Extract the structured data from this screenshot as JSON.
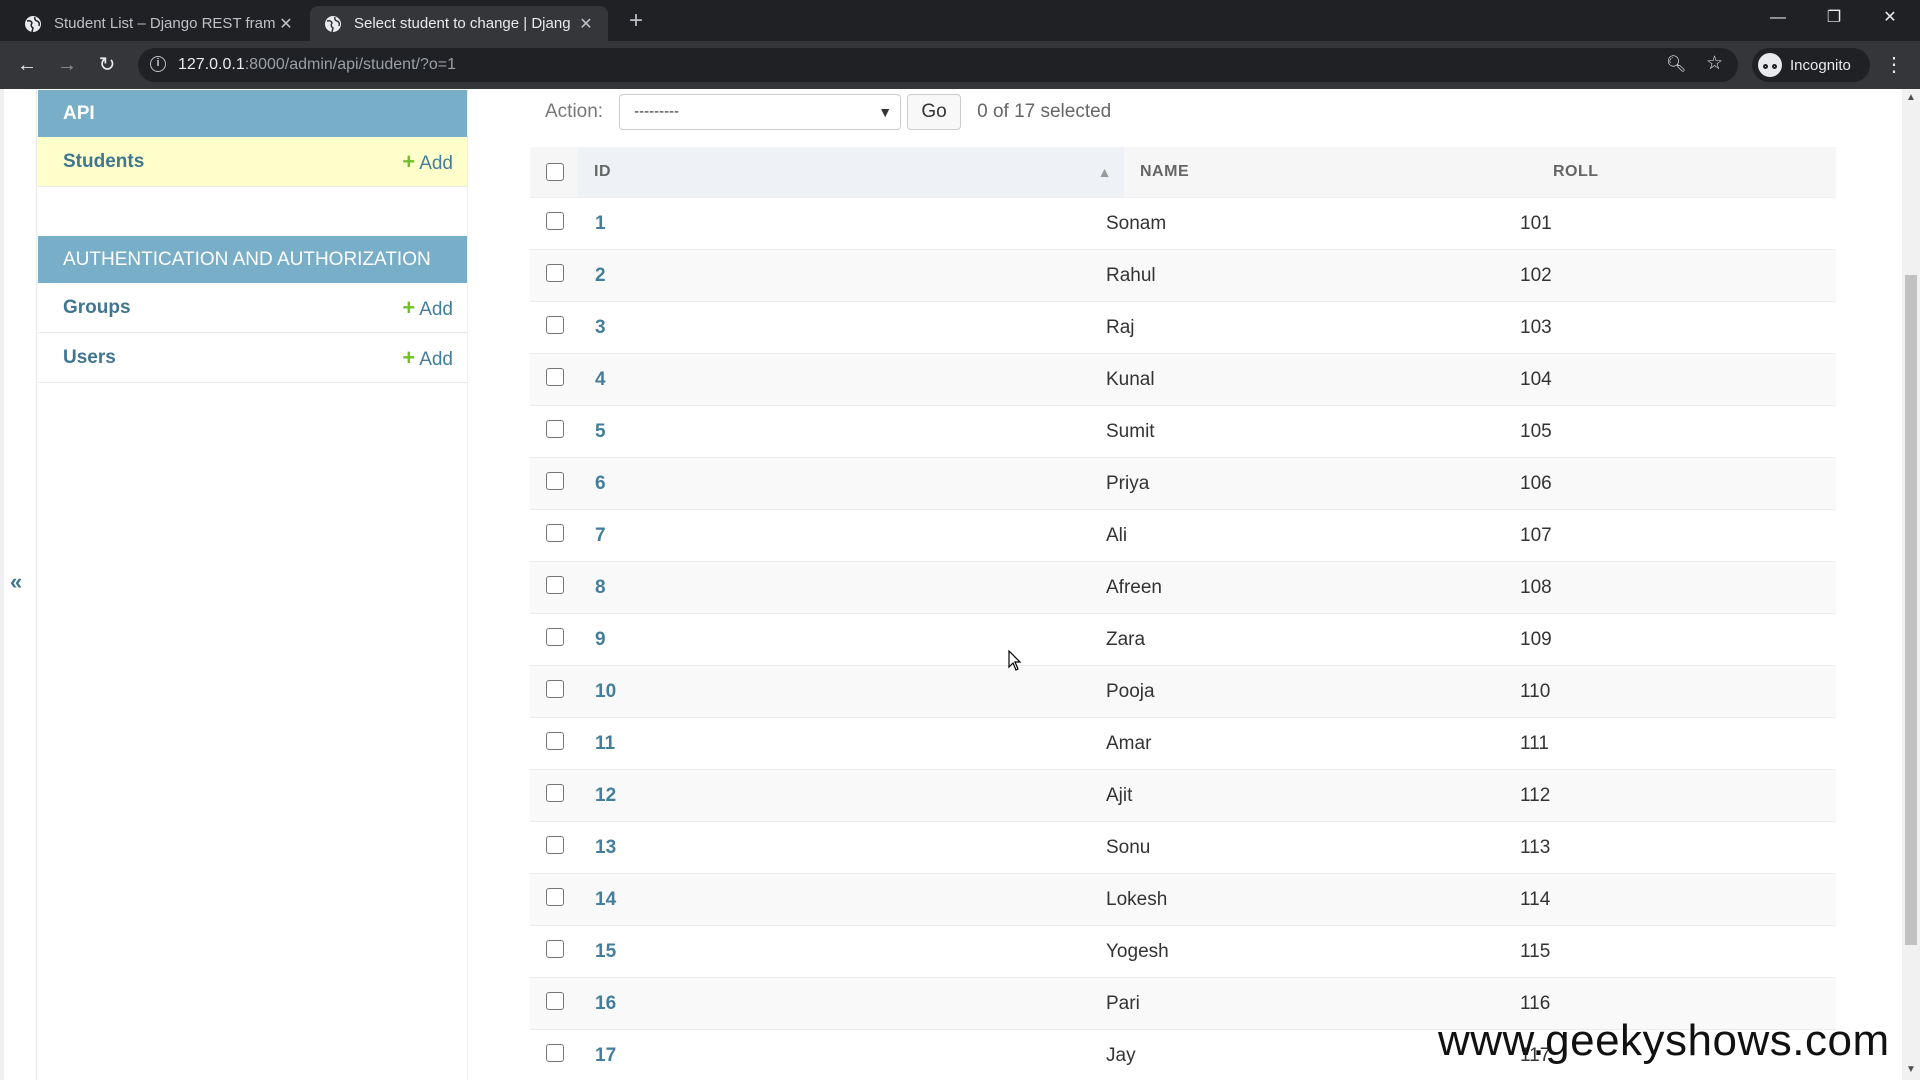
{
  "browser": {
    "tabs": [
      {
        "title": "Student List – Django REST frame",
        "active": false
      },
      {
        "title": "Select student to change | Djang",
        "active": true
      }
    ],
    "url_host": "127.0.0.1",
    "url_rest": ":8000/admin/api/student/?o=1",
    "profile_label": "Incognito",
    "window_controls": [
      "—",
      "❐",
      "✕"
    ]
  },
  "sidebar": {
    "collapse_label": "«",
    "modules": [
      {
        "caption": "API",
        "items": [
          {
            "label": "Students",
            "add": "Add",
            "current": true
          }
        ]
      },
      {
        "caption": "AUTHENTICATION AND AUTHORIZATION",
        "items": [
          {
            "label": "Groups",
            "add": "Add",
            "current": false
          },
          {
            "label": "Users",
            "add": "Add",
            "current": false
          }
        ]
      }
    ]
  },
  "actions": {
    "label": "Action:",
    "selected_option": "---------",
    "go_label": "Go",
    "counter": "0 of 17 selected"
  },
  "table": {
    "headers": {
      "id": "ID",
      "name": "NAME",
      "roll": "ROLL"
    },
    "rows": [
      {
        "id": "1",
        "name": "Sonam",
        "roll": "101"
      },
      {
        "id": "2",
        "name": "Rahul",
        "roll": "102"
      },
      {
        "id": "3",
        "name": "Raj",
        "roll": "103"
      },
      {
        "id": "4",
        "name": "Kunal",
        "roll": "104"
      },
      {
        "id": "5",
        "name": "Sumit",
        "roll": "105"
      },
      {
        "id": "6",
        "name": "Priya",
        "roll": "106"
      },
      {
        "id": "7",
        "name": "Ali",
        "roll": "107"
      },
      {
        "id": "8",
        "name": "Afreen",
        "roll": "108"
      },
      {
        "id": "9",
        "name": "Zara",
        "roll": "109"
      },
      {
        "id": "10",
        "name": "Pooja",
        "roll": "110"
      },
      {
        "id": "11",
        "name": "Amar",
        "roll": "111"
      },
      {
        "id": "12",
        "name": "Ajit",
        "roll": "112"
      },
      {
        "id": "13",
        "name": "Sonu",
        "roll": "113"
      },
      {
        "id": "14",
        "name": "Lokesh",
        "roll": "114"
      },
      {
        "id": "15",
        "name": "Yogesh",
        "roll": "115"
      },
      {
        "id": "16",
        "name": "Pari",
        "roll": "116"
      },
      {
        "id": "17",
        "name": "Jay",
        "roll": "117"
      }
    ]
  },
  "watermark": "www.geekyshows.com",
  "colors": {
    "module_caption": "#79aec8",
    "current_row": "#ffffcc",
    "link": "#447e9b",
    "add_plus": "#70bf2b"
  }
}
